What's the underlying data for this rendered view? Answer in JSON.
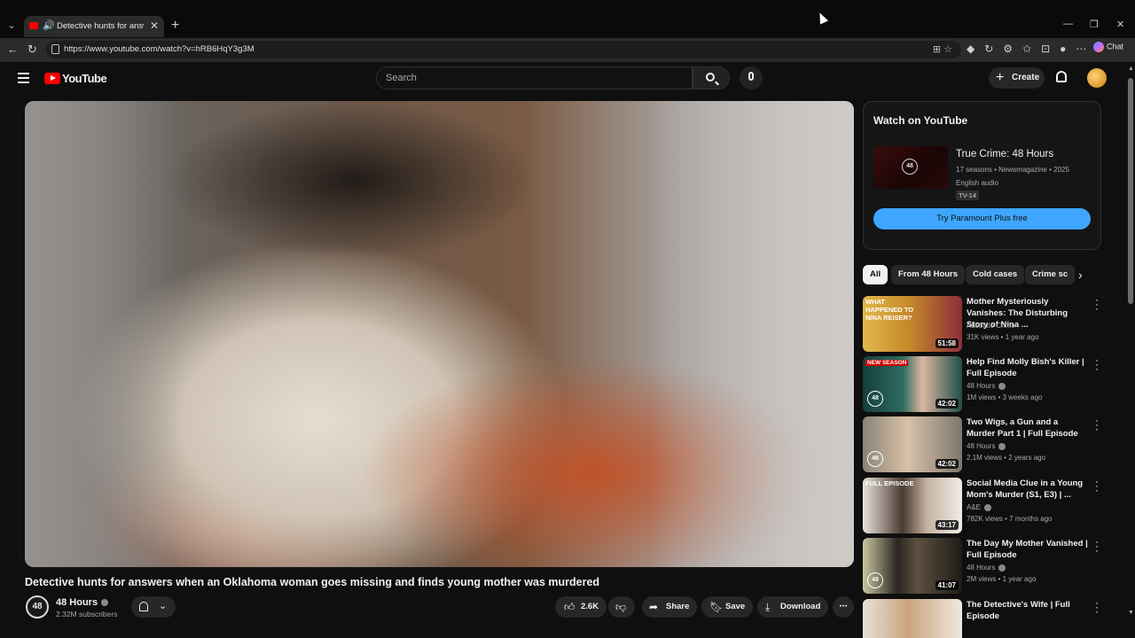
{
  "browser": {
    "tab_title": "Detective hunts for answers when an Oklahoma",
    "tab_close": "✕",
    "new_tab": "+",
    "url": "https://www.youtube.com/watch?v=hRB6HqY3g3M",
    "chat_label": "Chat",
    "window_controls": {
      "minimize": "—",
      "restore": "❐",
      "close": "✕"
    }
  },
  "header": {
    "logo_text": "YouTube",
    "search_placeholder": "Search",
    "create_label": "Create"
  },
  "video": {
    "title": "Detective hunts for answers when an Oklahoma woman goes missing and finds young mother was murdered",
    "channel_name": "48 Hours",
    "channel_avatar": "48",
    "subscribers": "2.32M subscribers",
    "likes": "2.6K",
    "share_label": "Share",
    "save_label": "Save",
    "download_label": "Download"
  },
  "watch_card": {
    "heading": "Watch on YouTube",
    "show_name": "True Crime: 48 Hours",
    "show_meta": "17 seasons • Newsmagazine • 2025",
    "audio": "English audio",
    "rating": "TV-14",
    "cta": "Try Paramount Plus free",
    "thumb_logo": "48"
  },
  "chips": [
    "All",
    "From 48 Hours",
    "Cold cases",
    "Crime sc"
  ],
  "recommendations": [
    {
      "title": "Mother Mysteriously Vanishes: The Disturbing Story of Nina ...",
      "channel": "Absolute Crime",
      "meta": "31K views • 1 year ago",
      "duration": "51:58",
      "overlay": "WHAT HAPPENED TO NINA REISER?"
    },
    {
      "title": "Help Find Molly Bish's Killer | Full Episode",
      "channel": "48 Hours",
      "meta": "1M views • 3 weeks ago",
      "duration": "42:02",
      "tag": "NEW SEASON"
    },
    {
      "title": "Two Wigs, a Gun and a Murder Part 1 | Full Episode",
      "channel": "48 Hours",
      "meta": "2.1M views • 2 years ago",
      "duration": "42:02"
    },
    {
      "title": "Social Media Clue in a Young Mom's Murder (S1, E3) | ...",
      "channel": "A&E",
      "meta": "782K views • 7 months ago",
      "duration": "43:17",
      "overlay": "FULL EPISODE"
    },
    {
      "title": "The Day My Mother Vanished | Full Episode",
      "channel": "48 Hours",
      "meta": "2M views • 1 year ago",
      "duration": "41:07"
    },
    {
      "title": "The Detective's Wife | Full Episode",
      "channel": "",
      "meta": "",
      "duration": ""
    }
  ],
  "colors": {
    "accent": "#3ea6ff",
    "brand": "#ff0000",
    "bg": "#0f0f0f"
  }
}
